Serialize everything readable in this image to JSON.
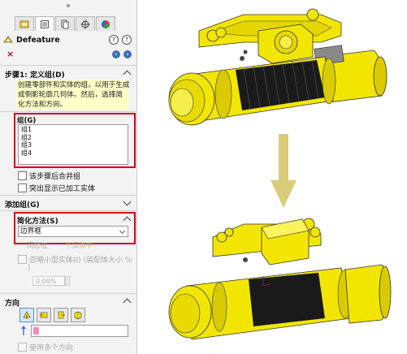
{
  "panel": {
    "title": "Defeature",
    "step": {
      "heading": "步骤1: 定义组(D)",
      "message_lines": [
        "创建零部件和实体的组，以用于生成",
        "成侧影轮廓几何体。然后，选择简",
        "化方法和方向。"
      ]
    },
    "groups": {
      "heading": "组(G)",
      "items": [
        "组1",
        "组2",
        "组3",
        "组4"
      ],
      "checkboxes": [
        {
          "label": "该步骤后合并组",
          "checked": false
        },
        {
          "label": "突出显示已加工实体",
          "checked": false
        }
      ]
    },
    "add_group": {
      "heading": "添加组(G)"
    },
    "simplify": {
      "heading": "简化方法(S)",
      "selected": "边界框",
      "sub_options": [
        "闭合在",
        "个实体中"
      ],
      "small_parts_label": "忽略小型实体(I) (装配体大小 %",
      "small_parts_label_end": ")",
      "percent_value": "0.00%"
    },
    "direction": {
      "heading": "方向",
      "use_multiple": "使用多个方向"
    }
  },
  "icons": {
    "tabs": [
      "feature-manager-icon",
      "property-manager-icon",
      "configuration-manager-icon",
      "dimxpert-icon",
      "display-manager-icon"
    ],
    "directions": [
      "direction-top-icon",
      "direction-front-icon",
      "direction-right-icon",
      "direction-iso-icon"
    ]
  },
  "colors": {
    "highlight_box": "#d0021b",
    "hoist_body": "#f2e600",
    "drum_black": "#1a1a1a",
    "arrow": "#d9cc7a",
    "message_bg": "#ffffc8"
  }
}
